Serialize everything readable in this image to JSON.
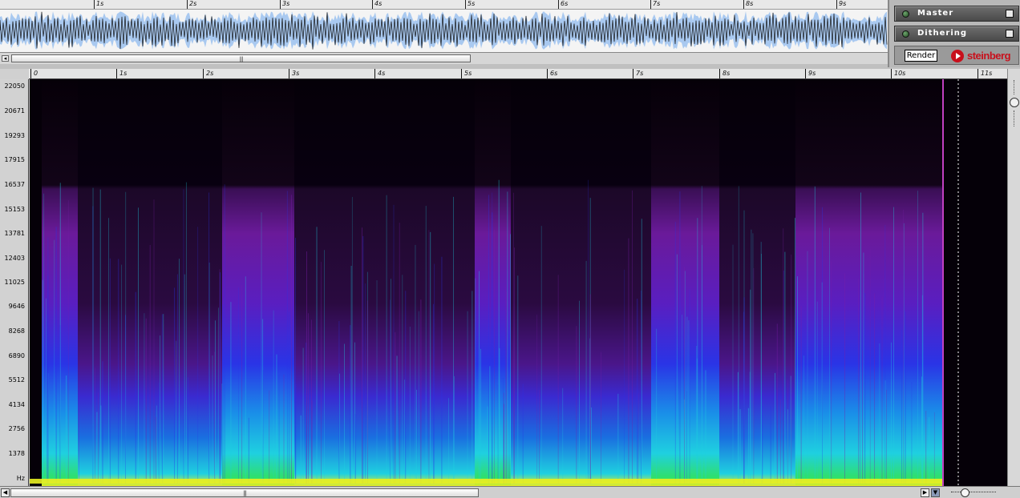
{
  "overview": {
    "ruler_labels": [
      "1s",
      "2s",
      "3s",
      "4s",
      "5s",
      "6s",
      "7s",
      "8s",
      "9s"
    ],
    "scroll_grip": "|||"
  },
  "panel": {
    "master_label": "Master",
    "dithering_label": "Dithering",
    "render_label": "Render",
    "logo_text": "steinberg"
  },
  "main_ruler": {
    "labels": [
      "0",
      "1s",
      "2s",
      "3s",
      "4s",
      "5s",
      "6s",
      "7s",
      "8s",
      "9s",
      "10s",
      "11s"
    ]
  },
  "yaxis": {
    "labels": [
      "22050",
      "20671",
      "19293",
      "17915",
      "16537",
      "15153",
      "13781",
      "12403",
      "11025",
      "9646",
      "8268",
      "6890",
      "5512",
      "4134",
      "2756",
      "1378",
      "Hz"
    ]
  },
  "bottom": {
    "scroll_grip": "|||",
    "arrow_left": "◀",
    "arrow_right": "▶",
    "arrow_down": "▼"
  },
  "colors": {
    "spectro_background": "#050008",
    "purple": "#7a1ea8",
    "blue": "#2a34e6",
    "cyan": "#1fd0e0",
    "yellow": "#e8ee22",
    "waveform_fill": "#a9c9f0",
    "logo_red": "#c8101c"
  }
}
